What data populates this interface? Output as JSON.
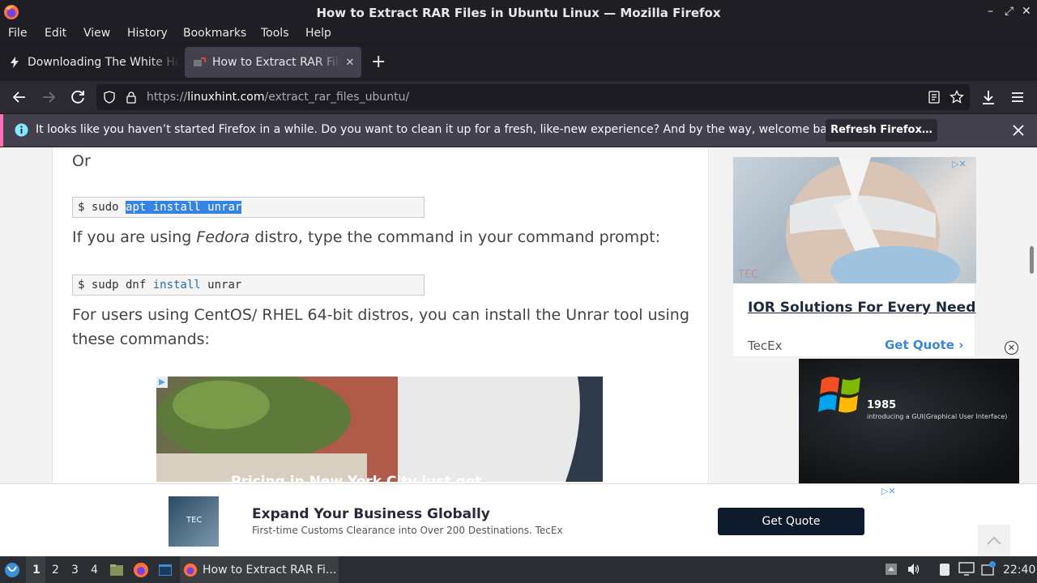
{
  "window": {
    "title": "How to Extract RAR Files in Ubuntu Linux — Mozilla Firefox"
  },
  "menu": [
    "File",
    "Edit",
    "View",
    "History",
    "Bookmarks",
    "Tools",
    "Help"
  ],
  "tabs": [
    {
      "label": "Downloading The White House",
      "active": false
    },
    {
      "label": "How to Extract RAR Files in Ubuntu",
      "active": true
    }
  ],
  "url": {
    "scheme": "https://",
    "host": "linuxhint.com",
    "path": "/extract_rar_files_ubuntu/"
  },
  "notification": {
    "message": "It looks like you haven’t started Firefox in a while. Do you want to clean it up for a fresh, like-new experience? And by the way, welcome back!",
    "button": "Refresh Firefox…"
  },
  "article": {
    "or_text": "Or",
    "cmd1": {
      "prompt": "$ sudo ",
      "selected": "apt install unrar"
    },
    "para_fedora_pre": "If you are using ",
    "para_fedora_em": "Fedora",
    "para_fedora_post": " distro, type the command in your command prompt:",
    "cmd2": {
      "prompt": "$ sudp dnf ",
      "kw": "install",
      "rest": " unrar"
    },
    "para_centos_1": "For users using CentOS/ RHEL 64-bit distros, you can install the Unrar tool using",
    "para_centos_2": "these commands:",
    "inline_ad_caption": "Pricing in New York City just got..."
  },
  "side_ad": {
    "title": "IOR Solutions For Every Need",
    "brand": "TecEx",
    "cta": "Get Quote",
    "img_logo": "TEC"
  },
  "video_ad": {
    "year": "1985",
    "caption": "introducing a GUI(Graphical User Interface)"
  },
  "bottom_ad": {
    "headline": "Expand Your Business Globally",
    "sub": "First-time Customs Clearance into Over 200 Destinations. TecEx",
    "button": "Get Quote",
    "logo": "TEC"
  },
  "taskbar": {
    "workspaces": [
      "1",
      "2",
      "3",
      "4"
    ],
    "active_task": "How to Extract RAR Fi...",
    "clock": "22:40"
  },
  "colors": {
    "accent": "#3584e4",
    "notification_border": "#ff6db7",
    "link": "#3a86d8"
  }
}
